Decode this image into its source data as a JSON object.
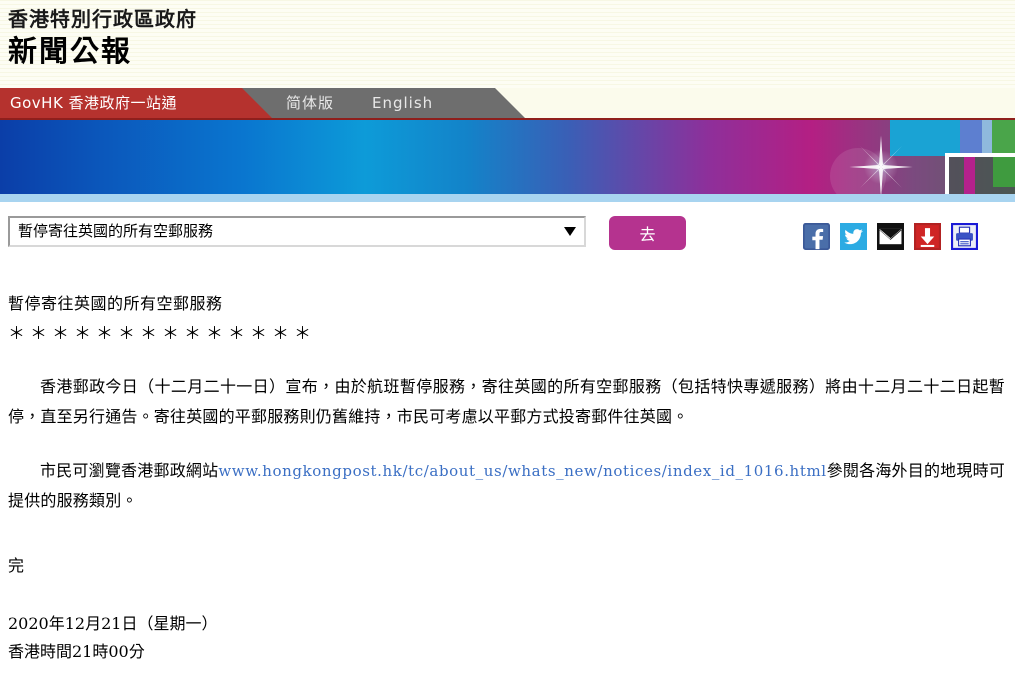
{
  "header": {
    "org_line": "香港特別行政區政府",
    "title_line": "新聞公報"
  },
  "nav": {
    "govhk_label": "GovHK 香港政府一站通",
    "simplified_label": "简体版",
    "english_label": "English"
  },
  "controls": {
    "select_value": "暫停寄往英國的所有空郵服務",
    "go_label": "去",
    "social_icons": [
      {
        "name": "facebook-icon",
        "title": "Facebook"
      },
      {
        "name": "twitter-icon",
        "title": "Twitter"
      },
      {
        "name": "email-icon",
        "title": "Email"
      },
      {
        "name": "download-icon",
        "title": "Download"
      },
      {
        "name": "print-icon",
        "title": "Print"
      }
    ]
  },
  "article": {
    "title": "暫停寄往英國的所有空郵服務",
    "stars": "＊＊＊＊＊＊＊＊＊＊＊＊＊＊",
    "paragraph1": "香港郵政今日（十二月二十一日）宣布，由於航班暫停服務，寄往英國的所有空郵服務（包括特快專遞服務）將由十二月二十二日起暫停，直至另行通告。寄往英國的平郵服務則仍舊維持，市民可考慮以平郵方式投寄郵件往英國。",
    "paragraph2_prefix": "市民可瀏覽香港郵政網站",
    "link_text": "www.hongkongpost.hk/tc/about_us/whats_new/notices/index_id_1016.html",
    "paragraph2_suffix": "參閱各海外目的地現時可提供的服務類別。",
    "end_mark": "完",
    "date_line": "2020年12月21日（星期一）",
    "time_line": "香港時間21時00分"
  },
  "colors": {
    "nav_red": "#b5322e",
    "nav_gray": "#6e6e6e",
    "go_button": "#b5338f",
    "link": "#3b6fc4",
    "header_bg": "#fbfbec"
  }
}
